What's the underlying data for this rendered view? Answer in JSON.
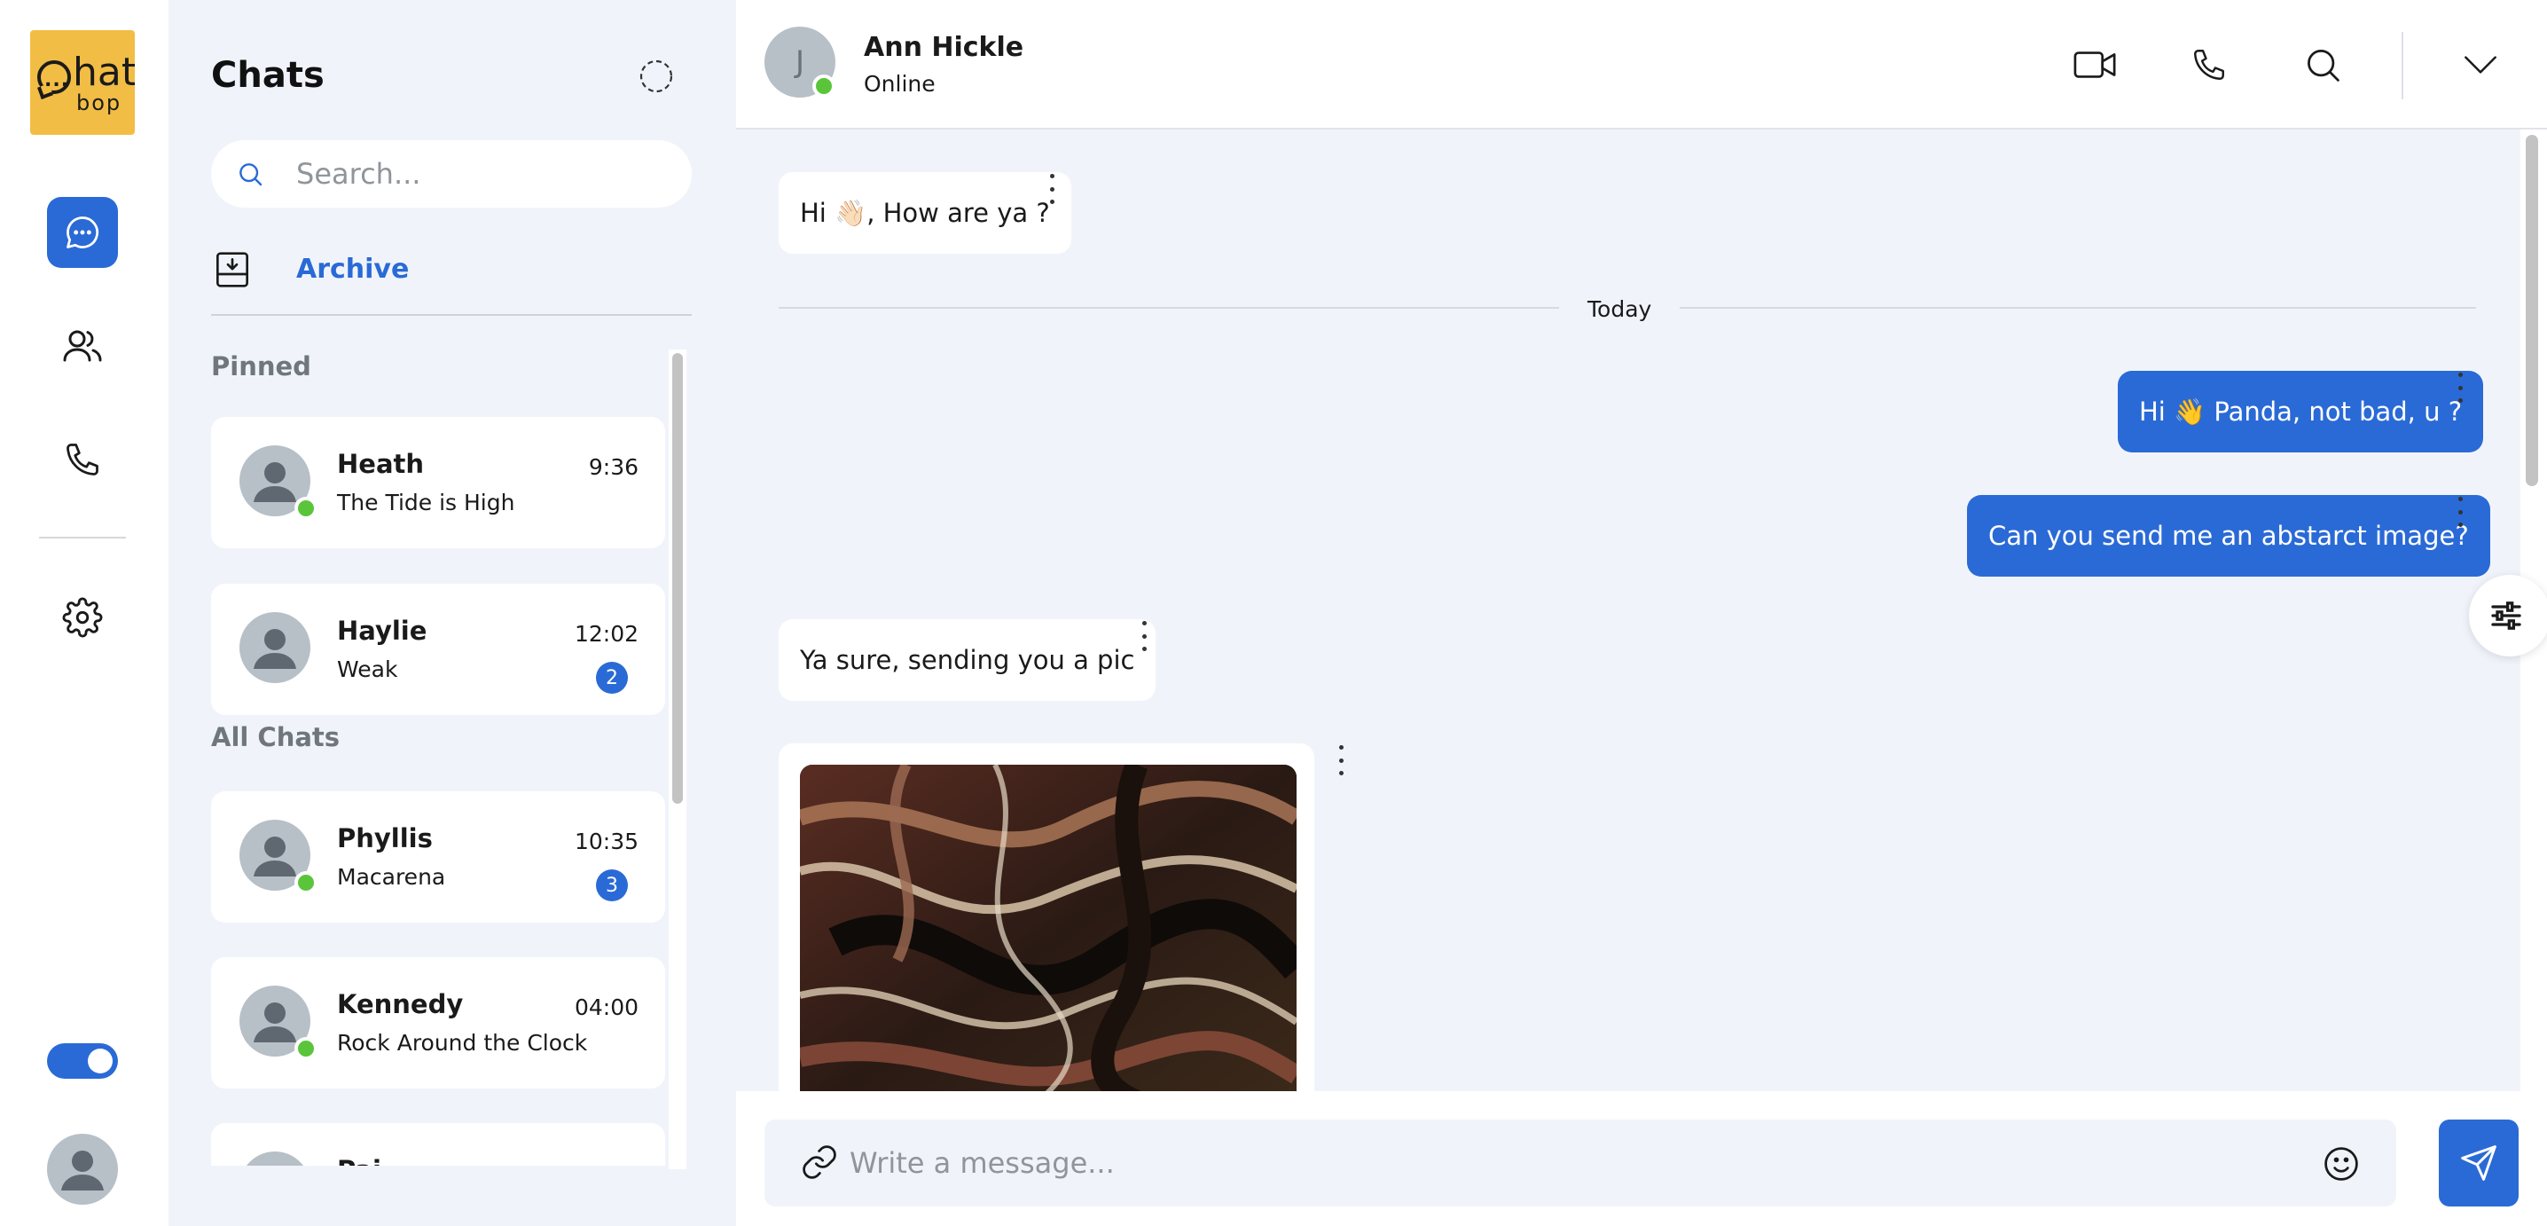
{
  "app": {
    "logo_big": "hat",
    "logo_small": "bop",
    "logo_dots": "..."
  },
  "rail": {
    "items": [
      {
        "icon": "chat-bubble-icon",
        "active": true
      },
      {
        "icon": "users-icon",
        "active": false
      },
      {
        "icon": "phone-icon",
        "active": false
      },
      {
        "icon": "gear-icon",
        "active": false
      }
    ],
    "theme_toggle_on": true
  },
  "chat_list": {
    "title": "Chats",
    "search_placeholder": "Search...",
    "archive_label": "Archive",
    "pinned_label": "Pinned",
    "all_label": "All Chats",
    "pinned": [
      {
        "name": "Heath",
        "message": "The Tide is High",
        "time": "9:36",
        "online": true,
        "unread": ""
      },
      {
        "name": "Haylie",
        "message": "Weak",
        "time": "12:02",
        "online": false,
        "unread": "2"
      }
    ],
    "all": [
      {
        "name": "Phyllis",
        "message": "Macarena",
        "time": "10:35",
        "online": true,
        "unread": "3"
      },
      {
        "name": "Kennedy",
        "message": "Rock Around the Clock",
        "time": "04:00",
        "online": true,
        "unread": ""
      },
      {
        "name": "Pai..",
        "message": "",
        "time": "",
        "online": false,
        "unread": ""
      }
    ]
  },
  "conversation": {
    "contact_initial": "J",
    "contact_name": "Ann Hickle",
    "contact_status": "Online",
    "day_divider": "Today",
    "messages": [
      {
        "dir": "in",
        "text": "Hi 👋🏻, How are ya ?"
      },
      {
        "dir": "out",
        "text": "Hi 👋 Panda, not bad, u ?"
      },
      {
        "dir": "out",
        "text": "Can you send me an abstarct image?"
      },
      {
        "dir": "in",
        "text": "Ya sure, sending you a pic"
      },
      {
        "dir": "in",
        "type": "image",
        "text": ""
      }
    ],
    "composer_placeholder": "Write a message..."
  },
  "colors": {
    "accent": "#2a6ad6",
    "logo_bg": "#f2bd44",
    "online": "#5ac53a",
    "panel_bg": "#f0f4fa"
  }
}
